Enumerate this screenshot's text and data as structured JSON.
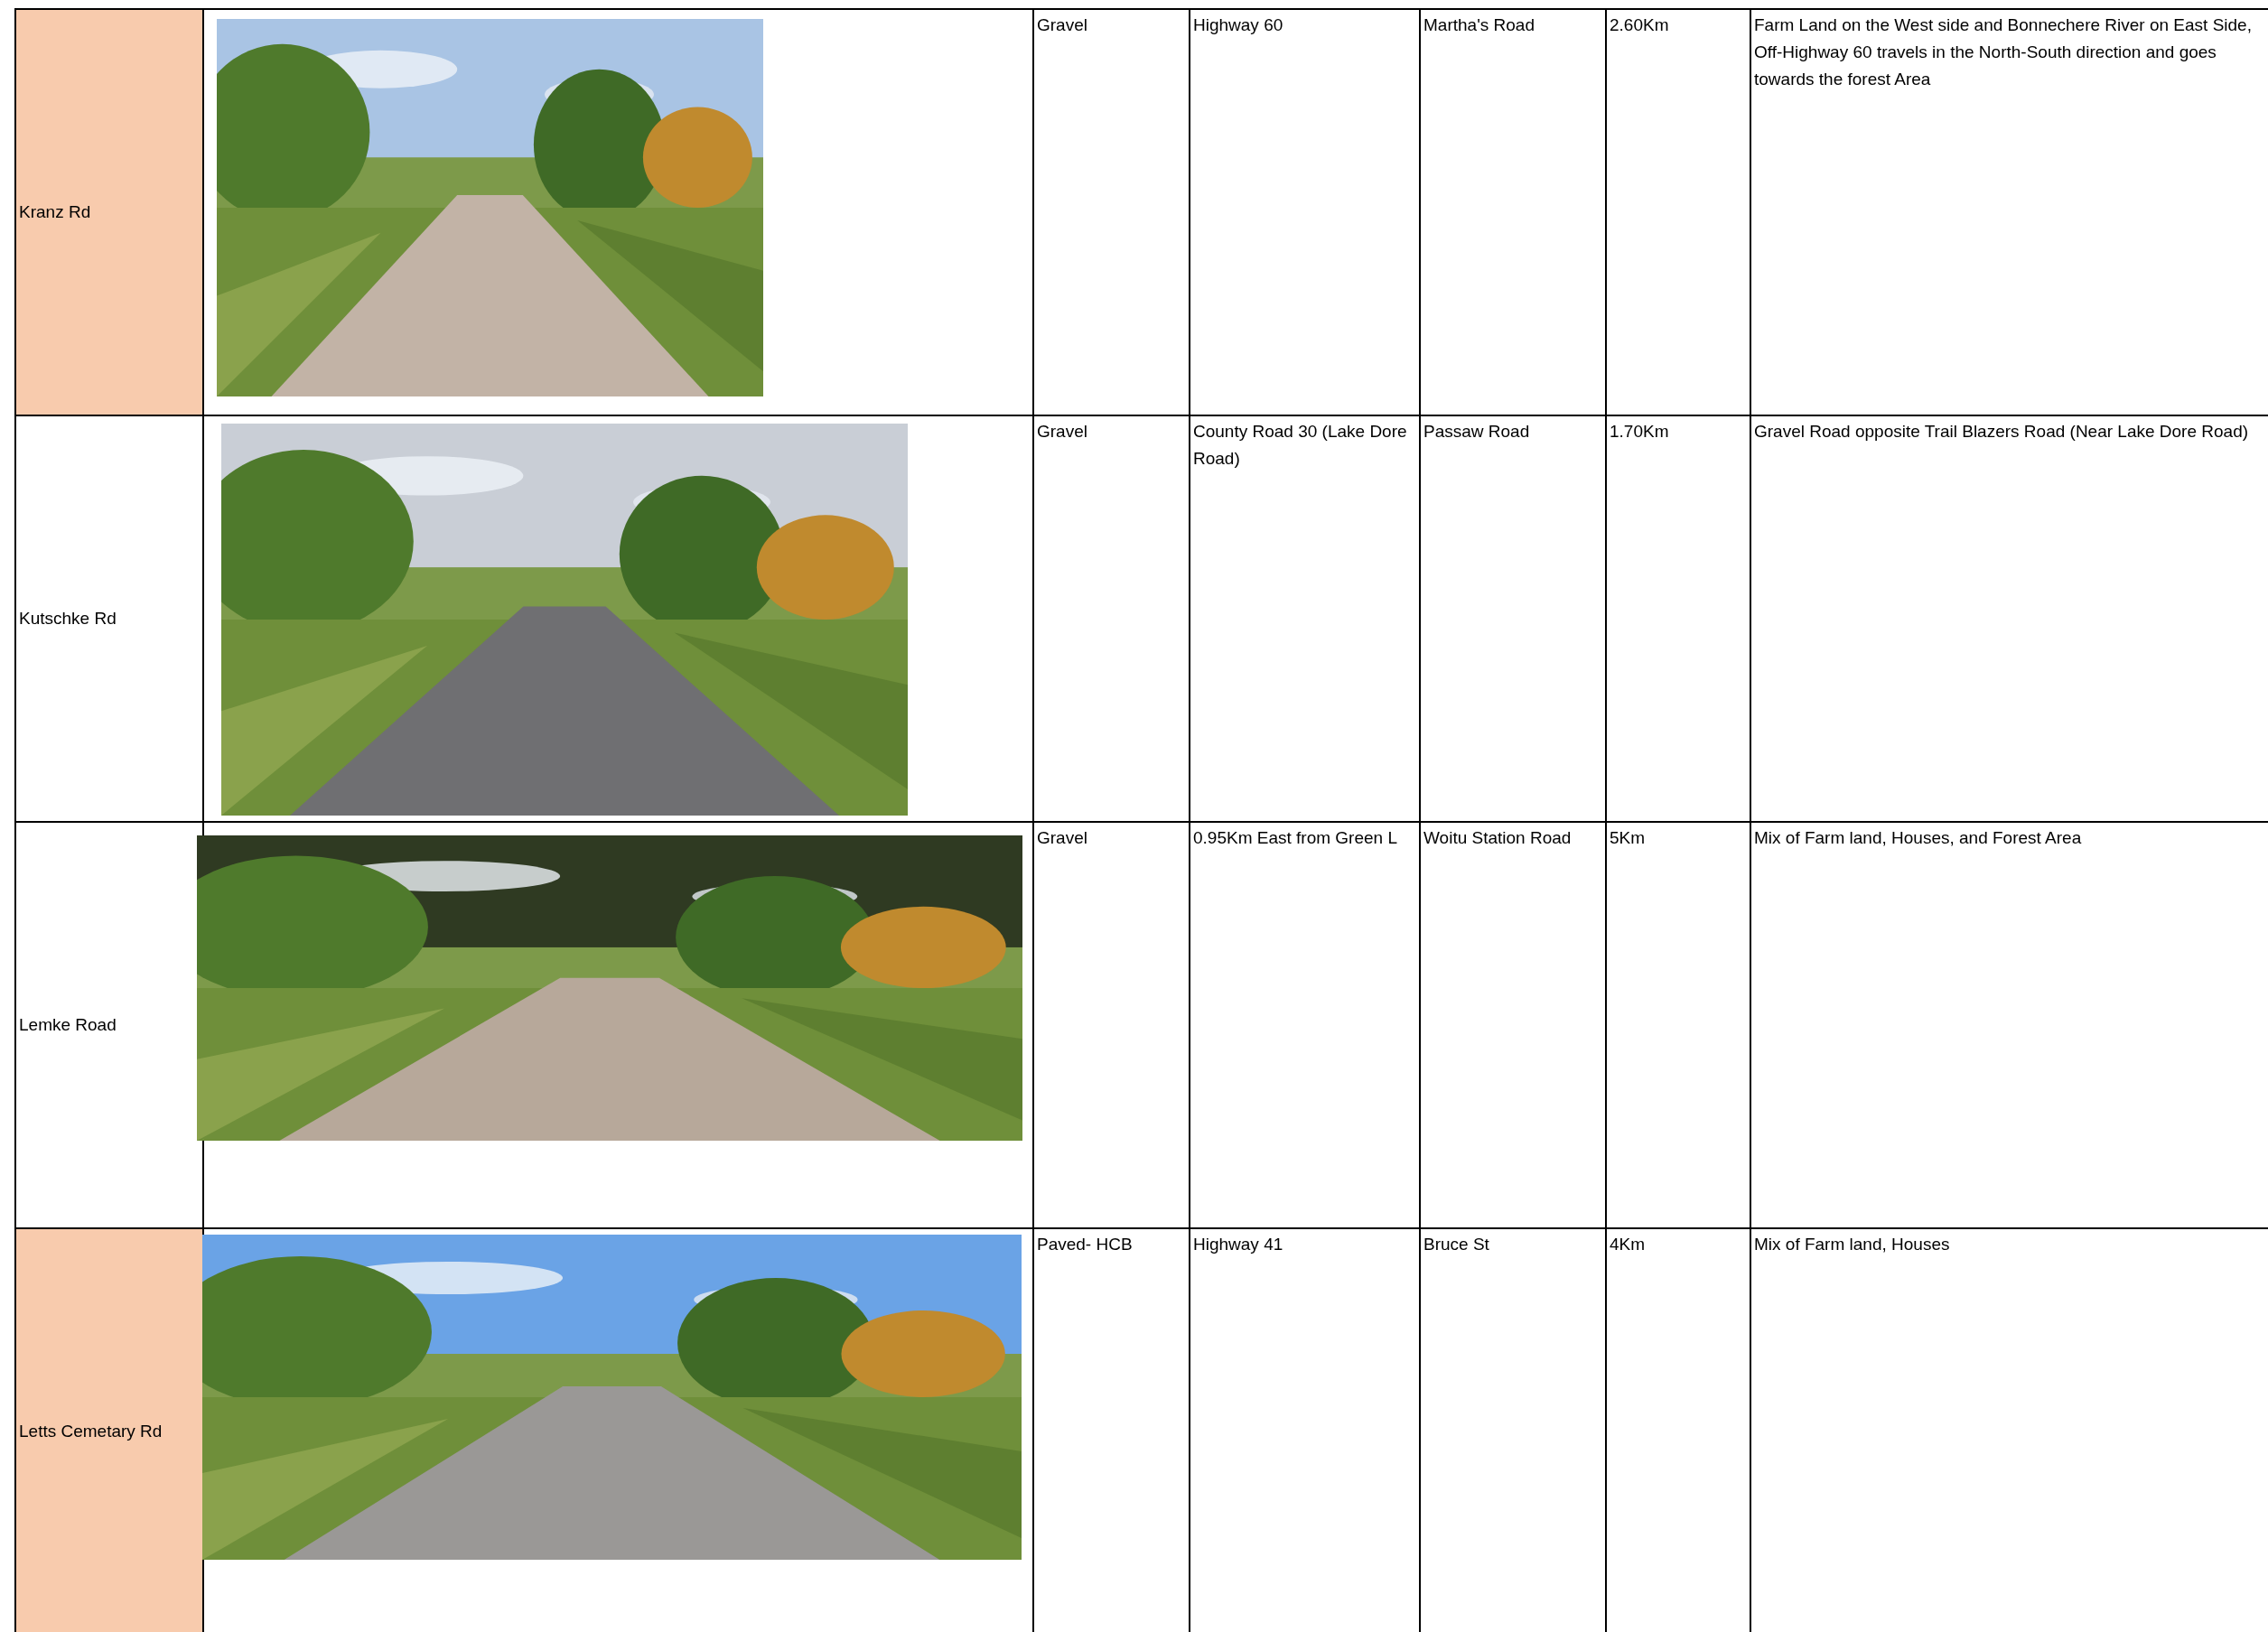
{
  "table": {
    "rows": [
      {
        "name": "Kranz Rd",
        "highlighted": true,
        "surface": "Gravel",
        "from": "Highway 60",
        "to": "Martha's Road",
        "length": "2.60Km",
        "description": "Farm Land on the West side and Bonnechere  River on East Side, Off-Highway 60 travels in the North-South direction and goes towards the forest Area"
      },
      {
        "name": "Kutschke Rd",
        "highlighted": false,
        "surface": "Gravel",
        "from": "County Road 30 (Lake Dore Road)",
        "to": "Passaw Road",
        "length": "1.70Km",
        "description": "Gravel Road opposite Trail Blazers Road (Near Lake Dore Road)"
      },
      {
        "name": "Lemke Road",
        "highlighted": false,
        "surface": "Gravel",
        "from": "0.95Km East from Green L",
        "to": "Woitu Station Road",
        "length": "5Km",
        "description": "Mix of Farm land, Houses, and Forest Area"
      },
      {
        "name": "Letts Cemetary Rd",
        "highlighted": true,
        "surface": "Paved- HCB",
        "from": "Highway 41",
        "to": "Bruce St",
        "length": "4Km",
        "description": "Mix of Farm land, Houses"
      }
    ]
  }
}
